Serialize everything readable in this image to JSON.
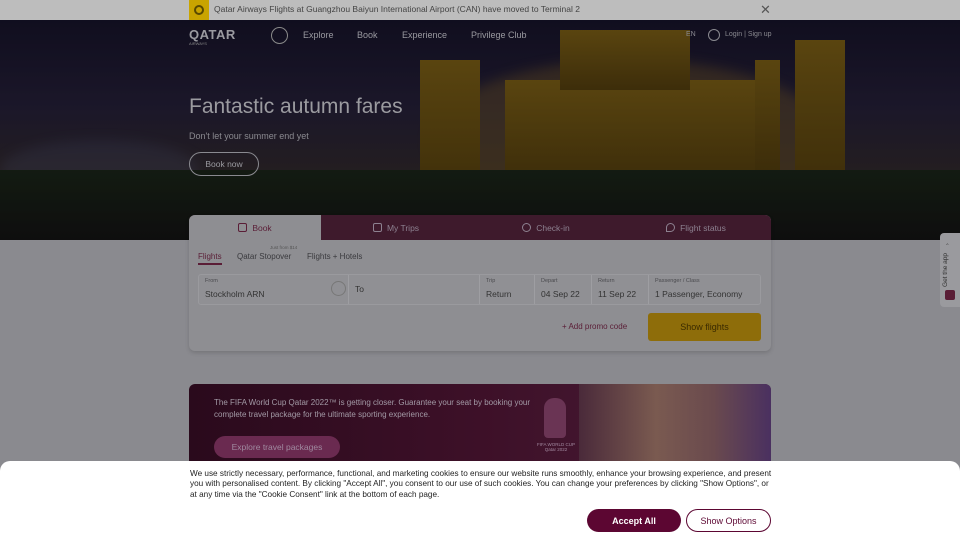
{
  "announcement": {
    "text": "Qatar Airways Flights at Guangzhou Baiyun International Airport (CAN) have moved to Terminal 2",
    "close_icon": "close-icon"
  },
  "nav": {
    "logo": "QATAR",
    "logo_sub": "AIRWAYS",
    "items": [
      "Explore",
      "Book",
      "Experience",
      "Privilege Club"
    ],
    "language": "EN",
    "login": "Login | Sign up"
  },
  "hero": {
    "title": "Fantastic autumn fares",
    "subtitle": "Don't let your summer end yet",
    "cta": "Book now"
  },
  "booking": {
    "tabs": [
      "Book",
      "My Trips",
      "Check-in",
      "Flight status"
    ],
    "subtabs": [
      "Flights",
      "Qatar Stopover",
      "Flights + Hotels"
    ],
    "stopover_badge": "Just from $14",
    "from_label": "From",
    "from_value": "Stockholm ARN",
    "to_label": "To",
    "trip_label": "Trip",
    "trip_value": "Return",
    "depart_label": "Depart",
    "depart_value": "04 Sep 22",
    "return_label": "Return",
    "return_value": "11 Sep 22",
    "pax_label": "Passenger / Class",
    "pax_value": "1 Passenger, Economy",
    "promo": "+ Add promo code",
    "submit": "Show flights"
  },
  "banner": {
    "text": "The FIFA World Cup Qatar 2022™ is getting closer. Guarantee your seat by booking your complete travel package for the ultimate sporting experience.",
    "button": "Explore travel packages",
    "trophy_text": "FIFA WORLD CUP Qatar 2022"
  },
  "app_tab": {
    "label": "Get the app"
  },
  "cookie": {
    "text": "We use strictly necessary, performance, functional, and marketing cookies to ensure our website runs smoothly, enhance your browsing experience, and present you with personalised content. By clicking \"Accept All\", you consent to our use of such cookies. You can change your preferences by clicking \"Show Options\", or at any time via the \"Cookie Consent\" link at the bottom of each page.",
    "accept": "Accept All",
    "options": "Show Options"
  },
  "colors": {
    "brand": "#5c0632",
    "cta_yellow": "#ffc000"
  }
}
